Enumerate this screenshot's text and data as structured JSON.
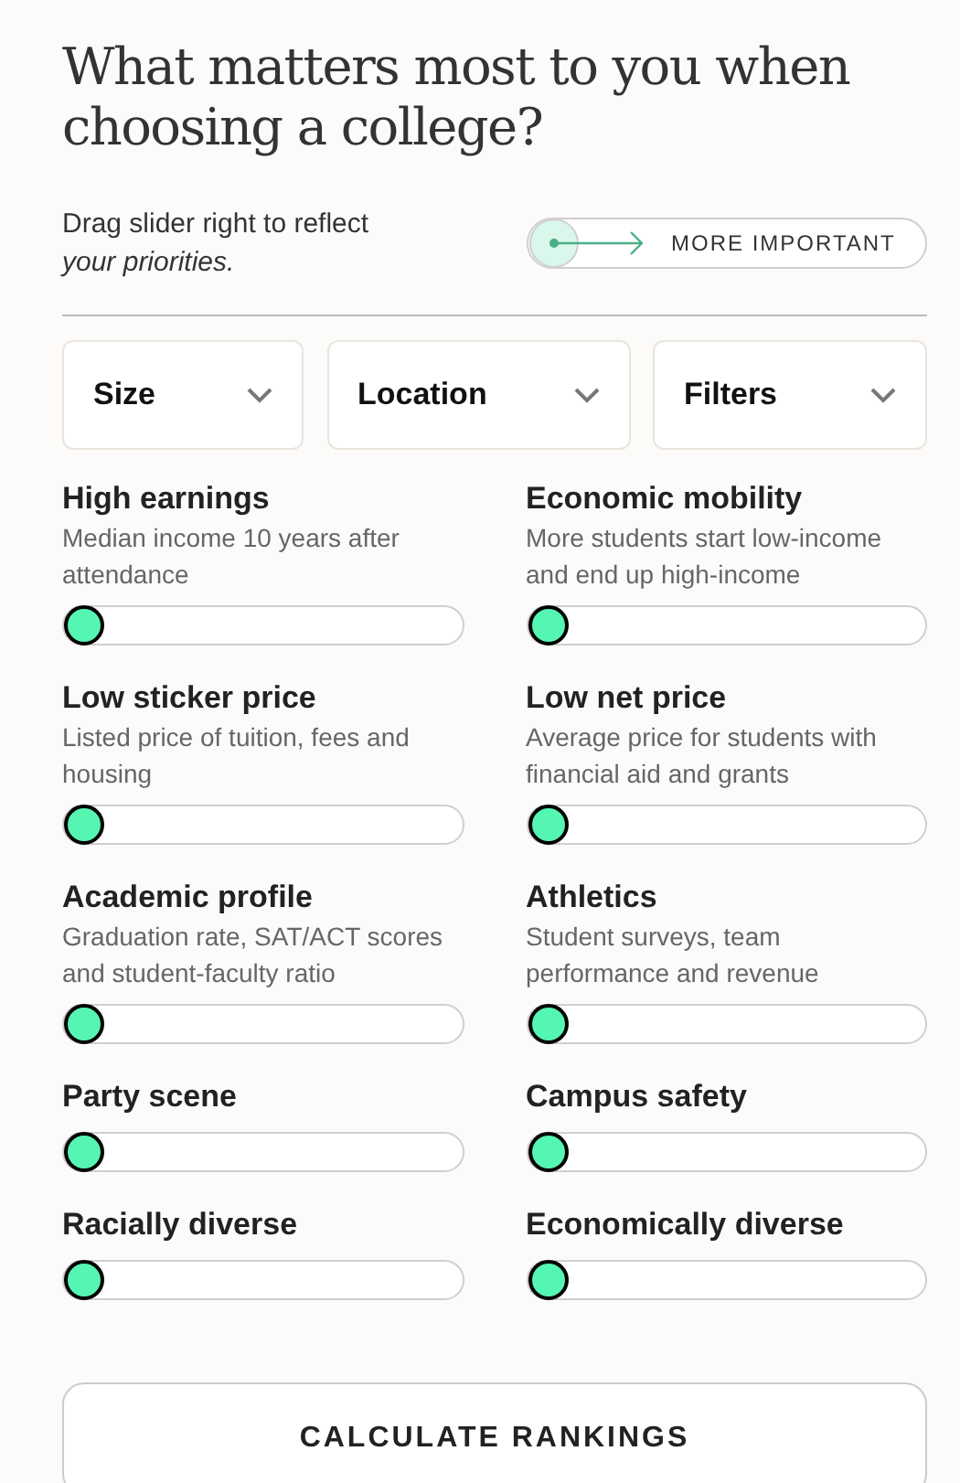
{
  "title": "What matters most to you when choosing a college?",
  "instruction": {
    "text": "Drag slider right to reflect *your priorities.*",
    "demo_label": "MORE IMPORTANT"
  },
  "dropdowns": [
    {
      "label": "Size"
    },
    {
      "label": "Location"
    },
    {
      "label": "Filters"
    }
  ],
  "priorities": [
    {
      "name": "High earnings",
      "description": "Median income 10 years after attendance",
      "level": 0
    },
    {
      "name": "Economic mobility",
      "description": "More students start low-income and end up high-income",
      "level": 0
    },
    {
      "name": "Low sticker price",
      "description": "Listed price of tuition, fees and housing",
      "level": 0
    },
    {
      "name": "Low net price",
      "description": "Average price for students with financial aid and grants",
      "level": 0
    },
    {
      "name": "Academic profile",
      "description": "Graduation rate, SAT/ACT scores and student-faculty ratio",
      "level": 0
    },
    {
      "name": "Athletics",
      "description": "Student surveys, team performance and revenue",
      "level": 0
    },
    {
      "name": "Party scene",
      "level": 0
    },
    {
      "name": "Campus safety",
      "level": 0
    },
    {
      "name": "Racially diverse",
      "level": 0
    },
    {
      "name": "Economically diverse",
      "level": 0
    }
  ],
  "submit_button": "CALCULATE RANKINGS"
}
